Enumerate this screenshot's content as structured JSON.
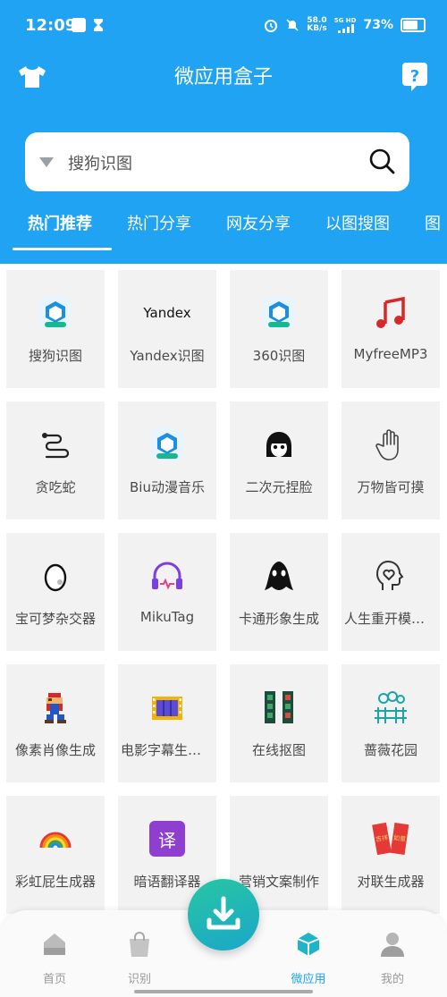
{
  "status_bar": {
    "time": "12:09",
    "speed_value": "58.0",
    "speed_unit": "KB/s",
    "network": "5G HD",
    "battery": "73%"
  },
  "app": {
    "title": "微应用盒子"
  },
  "search": {
    "selected": "搜狗识图"
  },
  "tabs": [
    "热门推荐",
    "热门分享",
    "网友分享",
    "以图搜图",
    "图"
  ],
  "grid": [
    {
      "label": "搜狗识图",
      "icon": "plus-badge-icon"
    },
    {
      "label": "Yandex识图",
      "icon": "yandex-logo",
      "logo_text": "Yandex"
    },
    {
      "label": "360识图",
      "icon": "plus-badge-icon"
    },
    {
      "label": "MyfreeMP3",
      "icon": "music-note-icon"
    },
    {
      "label": "贪吃蛇",
      "icon": "snake-icon"
    },
    {
      "label": "Biu动漫音乐",
      "icon": "plus-badge-icon"
    },
    {
      "label": "二次元捏脸",
      "icon": "anime-face-icon"
    },
    {
      "label": "万物皆可摸",
      "icon": "hand-icon"
    },
    {
      "label": "宝可梦杂交器",
      "icon": "egg-icon"
    },
    {
      "label": "MikuTag",
      "icon": "headphones-icon"
    },
    {
      "label": "卡通形象生成",
      "icon": "ghost-icon"
    },
    {
      "label": "人生重开模拟器",
      "icon": "head-heart-icon"
    },
    {
      "label": "像素肖像生成",
      "icon": "pixel-mario-icon"
    },
    {
      "label": "电影字幕生成器",
      "icon": "film-icon"
    },
    {
      "label": "在线抠图",
      "icon": "film-strips-icon"
    },
    {
      "label": "蔷薇花园",
      "icon": "garden-fence-icon"
    },
    {
      "label": "彩虹屁生成器",
      "icon": "rainbow-icon"
    },
    {
      "label": "暗语翻译器",
      "icon": "translate-icon",
      "logo_text": "译"
    },
    {
      "label": "营销文案制作",
      "icon": "marketing-icon"
    },
    {
      "label": "对联生成器",
      "icon": "couplet-icon",
      "logo_text_left": "吉祥",
      "logo_text_right": "如意"
    }
  ],
  "bottom_nav": [
    {
      "label": "首页",
      "icon": "home-icon",
      "active": false
    },
    {
      "label": "识别",
      "icon": "bag-icon",
      "active": false
    },
    {
      "label": "微应用",
      "icon": "cube-icon",
      "active": true
    },
    {
      "label": "我的",
      "icon": "user-icon",
      "active": false
    }
  ],
  "colors": {
    "primary": "#1fa3f2",
    "fab_start": "#28c6a3",
    "fab_end": "#1aa7c9"
  }
}
